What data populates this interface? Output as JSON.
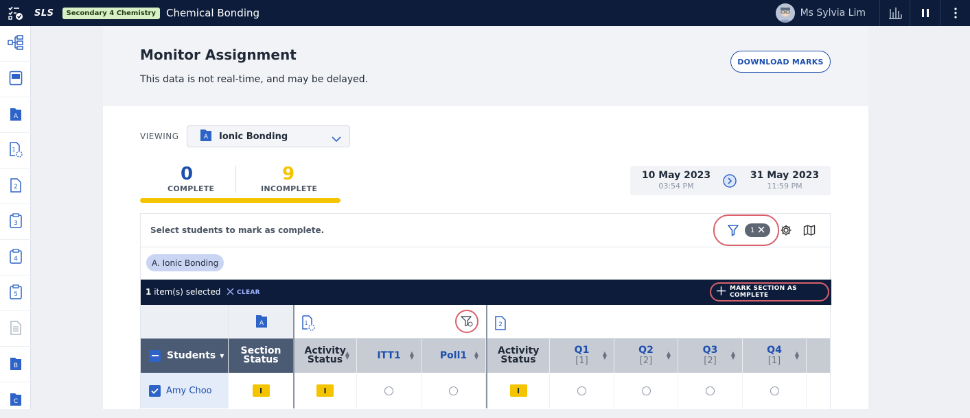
{
  "topbar": {
    "logo": "SLS",
    "subject_badge": "Secondary 4 Chemistry",
    "course_title": "Chemical Bonding",
    "user_name": "Ms Sylvia Lim"
  },
  "sidebar": {
    "items": [
      {
        "icon": "lesson-map-icon"
      },
      {
        "icon": "book-icon"
      },
      {
        "icon": "section-a-icon",
        "letter": "A"
      },
      {
        "icon": "activity-1-icon",
        "letter": "1"
      },
      {
        "icon": "activity-2-icon",
        "letter": "2"
      },
      {
        "icon": "activity-3-icon",
        "letter": "3"
      },
      {
        "icon": "activity-4-icon",
        "letter": "4"
      },
      {
        "icon": "activity-5-icon",
        "letter": "5"
      },
      {
        "icon": "document-icon"
      },
      {
        "icon": "section-b-icon",
        "letter": "B"
      },
      {
        "icon": "section-c-icon",
        "letter": "C"
      }
    ]
  },
  "header": {
    "title": "Monitor Assignment",
    "subtitle": "This data is not real-time, and may be delayed.",
    "download_label": "DOWNLOAD MARKS"
  },
  "viewing": {
    "label": "VIEWING",
    "badge": "A",
    "value": "Ionic Bonding"
  },
  "counts": {
    "complete": "0",
    "complete_label": "COMPLETE",
    "incomplete": "9",
    "incomplete_label": "INCOMPLETE",
    "complete_fraction": 0.0
  },
  "dates": {
    "start_date": "10 May 2023",
    "start_time": "03:54 PM",
    "end_date": "31 May 2023",
    "end_time": "11:59 PM"
  },
  "panel": {
    "hint": "Select students to mark as complete.",
    "filter_count": "1",
    "section_chip": "A. Ionic Bonding"
  },
  "selection": {
    "count": "1",
    "text": "item(s) selected",
    "clear_label": "CLEAR",
    "mark_label": "MARK SECTION AS COMPLETE"
  },
  "table": {
    "icon_row": {
      "section_badge": "A",
      "activity1_badge": "1",
      "activity2_badge": "2"
    },
    "headers": {
      "students": "Students",
      "section_status": "Section Status",
      "activity_status_1": "Activity Status",
      "itt1": "ITT1",
      "poll1": "Poll1",
      "activity_status_2": "Activity Status",
      "q1": "Q1",
      "q1_marks": "[1]",
      "q2": "Q2",
      "q2_marks": "[2]",
      "q3": "Q3",
      "q3_marks": "[2]",
      "q4": "Q4",
      "q4_marks": "[1]"
    },
    "rows": [
      {
        "student": "Amy Choo",
        "checked": true,
        "section_status": "I",
        "activity_status_1": "I",
        "activity_status_2": "I"
      }
    ]
  },
  "colors": {
    "topbar": "#0c1c3a",
    "accent": "#1d4fae",
    "incomplete": "#f5c400",
    "highlight_ring": "#d9606a"
  }
}
